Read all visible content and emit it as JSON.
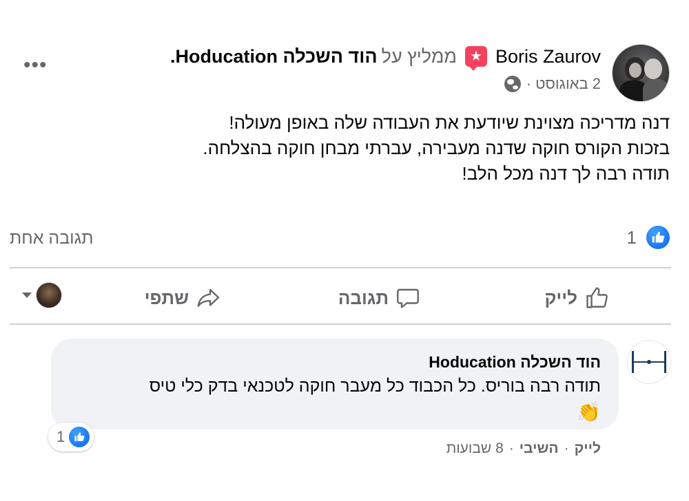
{
  "post": {
    "author": "Boris Zaurov",
    "recommends_text": "ממליץ על",
    "page_name": "הוד השכלה Hoducation.",
    "date": "2 באוגוסט ·",
    "body_lines": [
      "דנה מדריכה מצוינת שיודעת את העבודה שלה באופן מעולה!",
      "בזכות הקורס חוקה שדנה מעבירה, עברתי מבחן חוקה בהצלחה.",
      "תודה רבה לך דנה מכל הלב!"
    ],
    "like_count": "1",
    "comments_count": "תגובה אחת",
    "more_options": "•••",
    "icons": {
      "more": "ellipsis-icon",
      "audience": "globe-icon",
      "recommend": "recommend-star-icon",
      "like": "like-thumb-icon",
      "comment": "comment-bubble-icon",
      "share": "share-arrow-icon"
    }
  },
  "actions": {
    "like_label": "לייק",
    "comment_label": "תגובה",
    "share_label": "שתפי"
  },
  "comment": {
    "author": "הוד השכלה Hoducation",
    "text": "תודה רבה בוריס. כל הכבוד כל מעבר חוקה לטכנאי בדק כלי טיס",
    "emoji": "👏",
    "reaction_count": "1",
    "like_action": "לייק",
    "reply_action": "השיבי",
    "separator": "·",
    "time": "8 שבועות"
  },
  "colors": {
    "accent": "#1877f2",
    "recommend": "#f3425f",
    "secondary_text": "#65676b",
    "bubble": "#f0f2f5"
  }
}
